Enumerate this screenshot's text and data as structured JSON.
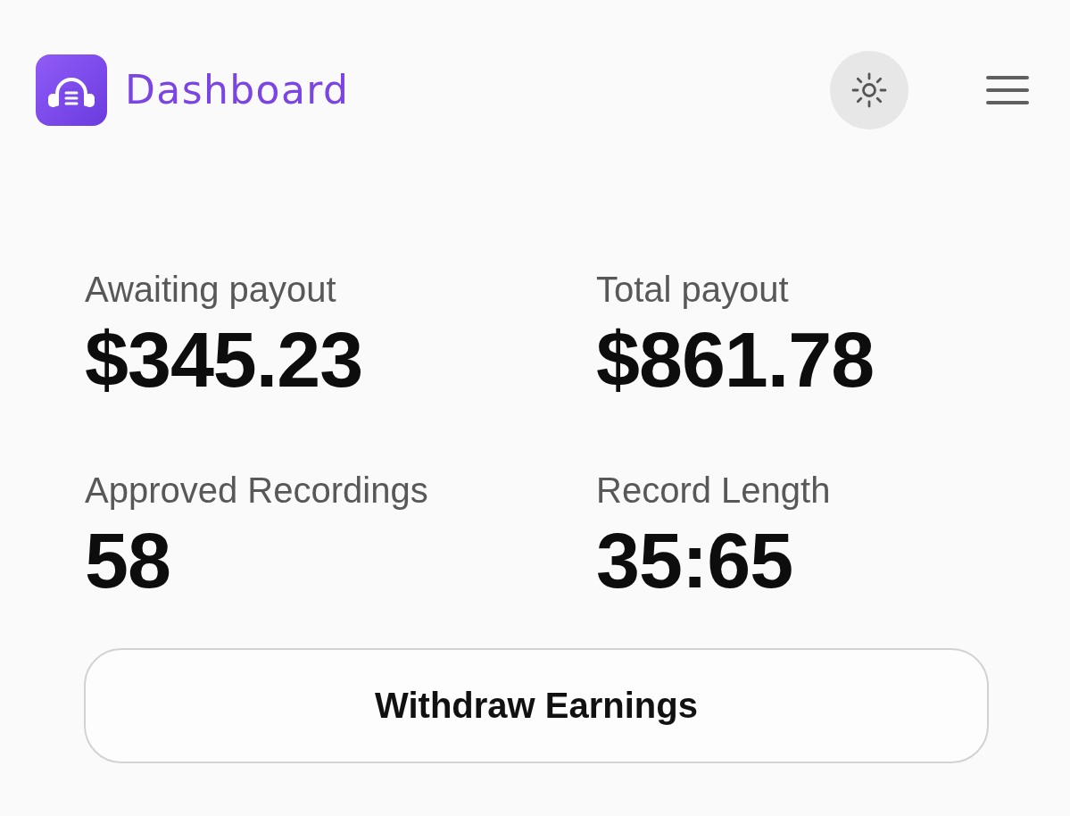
{
  "header": {
    "title": "Dashboard"
  },
  "stats": [
    {
      "label": "Awaiting payout",
      "value": "$345.23"
    },
    {
      "label": "Total payout",
      "value": "$861.78"
    },
    {
      "label": "Approved Recordings",
      "value": "58"
    },
    {
      "label": "Record Length",
      "value": "35:65"
    }
  ],
  "withdraw_button": {
    "label": "Withdraw Earnings"
  }
}
